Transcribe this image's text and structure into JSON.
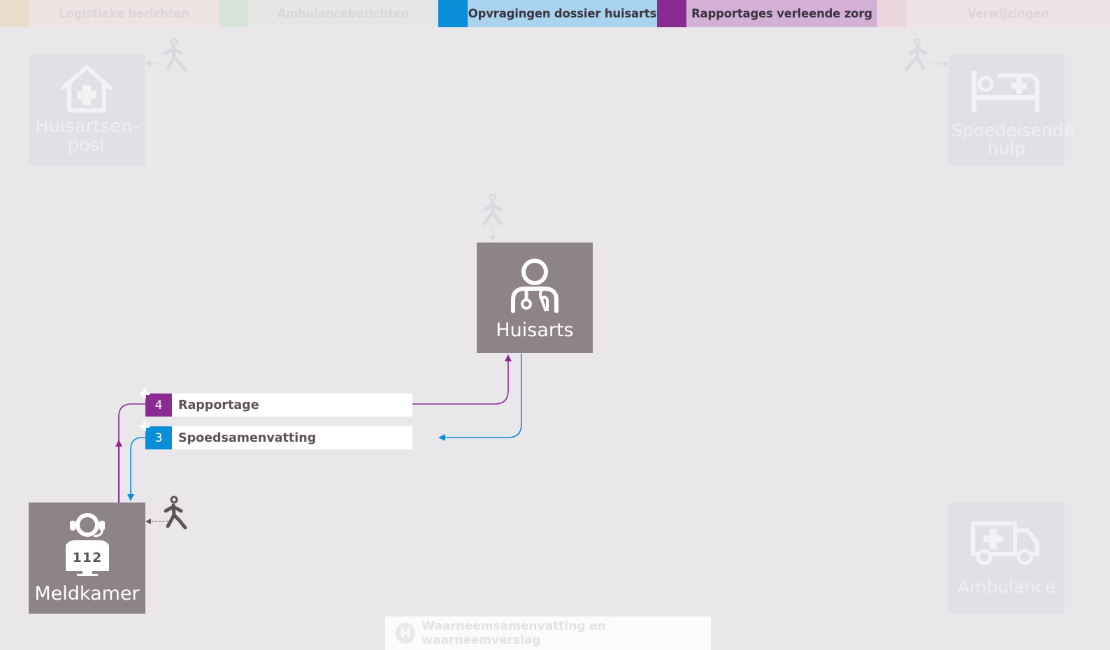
{
  "tabs": [
    {
      "label": "Logistieke berichten",
      "color": "#e9c9a7",
      "active": false
    },
    {
      "label": "Ambulanceberichten",
      "color": "#a8d5b1",
      "active": false
    },
    {
      "label": "Opvragingen dossier huisarts",
      "color": "#0a8ed8",
      "active": true
    },
    {
      "label": "Rapportages verleende zorg",
      "color": "#8a2b94",
      "active": true
    },
    {
      "label": "Verwijzingen",
      "color": "#e8a2bf",
      "active": false
    }
  ],
  "nodes": {
    "huisartsenpost": {
      "label": "Huisartsen-post",
      "icon": "home-plus-icon",
      "active": false
    },
    "spoedeisende_hulp": {
      "label": "Spoedeisende hulp",
      "icon": "hospital-bed-icon",
      "active": false
    },
    "huisarts": {
      "label": "Huisarts",
      "icon": "doctor-icon",
      "active": true
    },
    "meldkamer": {
      "label": "Meldkamer",
      "icon": "operator-112-icon",
      "screen_text": "112",
      "active": true
    },
    "ambulance": {
      "label": "Ambulance",
      "icon": "ambulance-icon",
      "active": false
    }
  },
  "messages": [
    {
      "number": "4",
      "label": "Rapportage",
      "color": "#8a2b94"
    },
    {
      "number": "3",
      "label": "Spoedsamenvatting",
      "color": "#0a8ed8"
    }
  ],
  "footer": {
    "badge": "H",
    "label": "Waarneemsamenvatting en waarneemverslag"
  },
  "colors": {
    "purple": "#8a2b94",
    "blue": "#0a8ed8",
    "node_active": "#8d8389",
    "node_faded": "#e2e0e4",
    "background": "#e9e7ea"
  }
}
